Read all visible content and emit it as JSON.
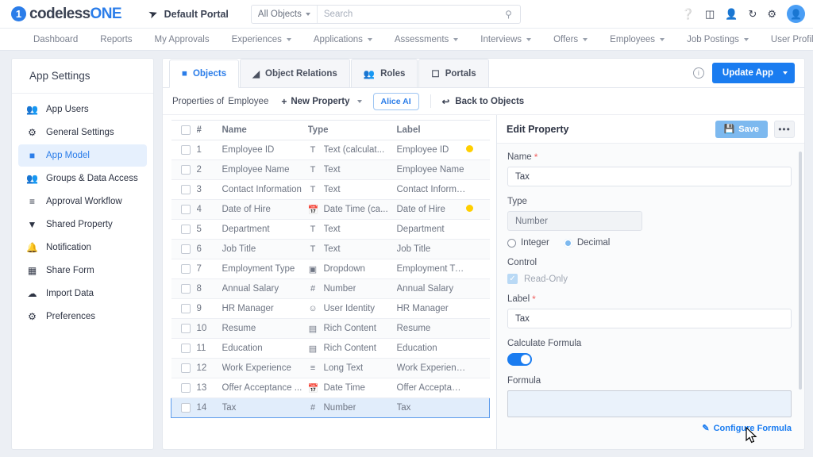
{
  "topbar": {
    "brand_mark": "1",
    "brand_dark": "codeless",
    "brand_blue": "ONE",
    "portal_name": "Default Portal",
    "portal_icon": "send-icon",
    "scope_label": "All Objects",
    "search_placeholder": "Search",
    "search_value": "",
    "icons": [
      "help-icon",
      "database-icon",
      "add-user-icon",
      "history-icon",
      "gear-icon",
      "account-avatar"
    ]
  },
  "nav": {
    "items": [
      {
        "label": "Dashboard",
        "caret": false
      },
      {
        "label": "Reports",
        "caret": false
      },
      {
        "label": "My Approvals",
        "caret": false
      },
      {
        "label": "Experiences",
        "caret": true
      },
      {
        "label": "Applications",
        "caret": true
      },
      {
        "label": "Assessments",
        "caret": true
      },
      {
        "label": "Interviews",
        "caret": true
      },
      {
        "label": "Offers",
        "caret": true
      },
      {
        "label": "Employees",
        "caret": true
      },
      {
        "label": "Job Postings",
        "caret": true
      },
      {
        "label": "User Profile",
        "caret": true
      }
    ]
  },
  "sidebar": {
    "title": "App Settings",
    "items": [
      {
        "label": "App Users",
        "icon": "users-icon",
        "active": false
      },
      {
        "label": "General Settings",
        "icon": "gear-icon",
        "active": false
      },
      {
        "label": "App Model",
        "icon": "cube-icon",
        "active": true
      },
      {
        "label": "Groups & Data Access",
        "icon": "group-icon",
        "active": false
      },
      {
        "label": "Approval Workflow",
        "icon": "checklist-icon",
        "active": false
      },
      {
        "label": "Shared Property",
        "icon": "tag-icon",
        "active": false
      },
      {
        "label": "Notification",
        "icon": "bell-icon",
        "active": false
      },
      {
        "label": "Share Form",
        "icon": "form-icon",
        "active": false
      },
      {
        "label": "Import Data",
        "icon": "cloud-upload-icon",
        "active": false
      },
      {
        "label": "Preferences",
        "icon": "hand-gear-icon",
        "active": false
      }
    ]
  },
  "tabs": [
    {
      "label": "Objects",
      "icon": "cube-icon",
      "active": true
    },
    {
      "label": "Object Relations",
      "icon": "relations-icon",
      "active": false
    },
    {
      "label": "Roles",
      "icon": "roles-icon",
      "active": false
    },
    {
      "label": "Portals",
      "icon": "portal-icon",
      "active": false
    }
  ],
  "header_actions": {
    "info_icon": "info-icon",
    "update_app_label": "Update App"
  },
  "toolbar": {
    "properties_of": "Properties of",
    "object_name": "Employee",
    "new_property_label": "New Property",
    "alice_label": "Alice AI",
    "back_label": "Back to Objects"
  },
  "table": {
    "columns": [
      "",
      "#",
      "Name",
      "Type",
      "Label",
      ""
    ],
    "rows": [
      {
        "num": "1",
        "name": "Employee ID",
        "type": "Text (calculat...",
        "type_icon": "text-icon",
        "label": "Employee ID",
        "flag": true
      },
      {
        "num": "2",
        "name": "Employee Name",
        "type": "Text",
        "type_icon": "text-icon",
        "label": "Employee Name",
        "flag": false
      },
      {
        "num": "3",
        "name": "Contact Information",
        "type": "Text",
        "type_icon": "text-icon",
        "label": "Contact Information",
        "flag": false
      },
      {
        "num": "4",
        "name": "Date of Hire",
        "type": "Date Time (ca...",
        "type_icon": "calendar-icon",
        "label": "Date of Hire",
        "flag": true
      },
      {
        "num": "5",
        "name": "Department",
        "type": "Text",
        "type_icon": "text-icon",
        "label": "Department",
        "flag": false
      },
      {
        "num": "6",
        "name": "Job Title",
        "type": "Text",
        "type_icon": "text-icon",
        "label": "Job Title",
        "flag": false
      },
      {
        "num": "7",
        "name": "Employment Type",
        "type": "Dropdown",
        "type_icon": "dropdown-icon",
        "label": "Employment Type",
        "flag": false
      },
      {
        "num": "8",
        "name": "Annual Salary",
        "type": "Number",
        "type_icon": "number-icon",
        "label": "Annual Salary",
        "flag": false
      },
      {
        "num": "9",
        "name": "HR Manager",
        "type": "User Identity",
        "type_icon": "user-icon",
        "label": "HR Manager",
        "flag": false
      },
      {
        "num": "10",
        "name": "Resume",
        "type": "Rich Content",
        "type_icon": "rich-icon",
        "label": "Resume",
        "flag": false
      },
      {
        "num": "11",
        "name": "Education",
        "type": "Rich Content",
        "type_icon": "rich-icon",
        "label": "Education",
        "flag": false
      },
      {
        "num": "12",
        "name": "Work Experience",
        "type": "Long Text",
        "type_icon": "longtext-icon",
        "label": "Work Experience",
        "flag": false
      },
      {
        "num": "13",
        "name": "Offer Acceptance ...",
        "type": "Date Time",
        "type_icon": "calendar-icon",
        "label": "Offer Acceptance ...",
        "flag": false
      },
      {
        "num": "14",
        "name": "Tax",
        "type": "Number",
        "type_icon": "number-icon",
        "label": "Tax",
        "flag": false,
        "selected": true
      }
    ]
  },
  "edit_panel": {
    "title": "Edit Property",
    "save_label": "Save",
    "more_label": "•••",
    "name_label": "Name",
    "name_value": "Tax",
    "type_label": "Type",
    "type_value": "Number",
    "radio_integer": "Integer",
    "radio_decimal": "Decimal",
    "radio_selected": "Decimal",
    "control_label": "Control",
    "readonly_label": "Read-Only",
    "readonly_checked": true,
    "label_label": "Label",
    "label_value": "Tax",
    "calculate_formula_label": "Calculate Formula",
    "calculate_formula_on": true,
    "formula_label": "Formula",
    "formula_value": "",
    "configure_formula_label": "Configure Formula"
  },
  "colors": {
    "accent": "#1a7cf0",
    "brand_blue": "#2b7de9",
    "flag_yellow": "#ffcf00",
    "selected_row": "#e1edfb",
    "panel_bg": "#fafbfc"
  }
}
